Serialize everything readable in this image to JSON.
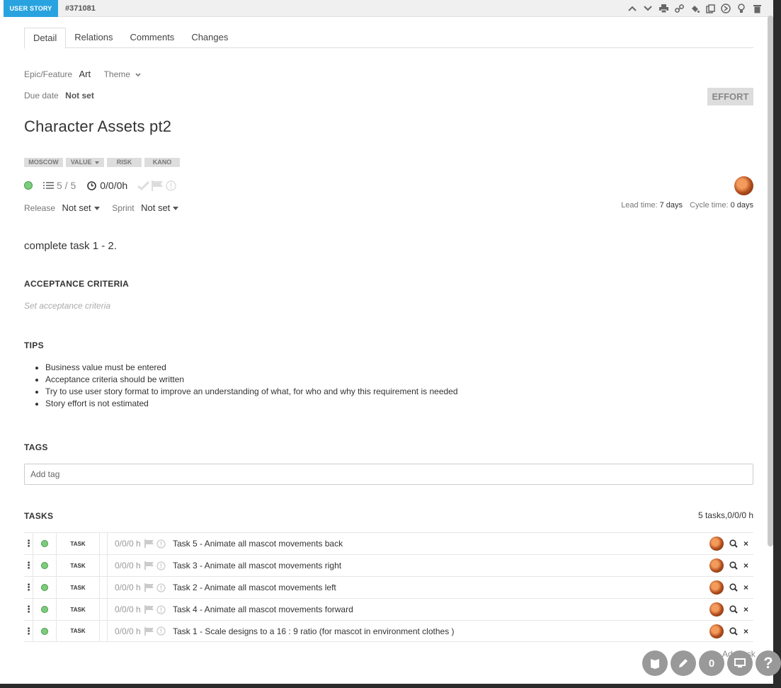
{
  "header": {
    "type_label": "USER STORY",
    "entity_id": "#371081",
    "icons": [
      "chevron-up-icon",
      "chevron-down-icon",
      "print-icon",
      "link-icon",
      "paint-bucket-icon",
      "copy-icon",
      "convert-icon",
      "lightbulb-icon",
      "trash-icon"
    ]
  },
  "tabs": [
    {
      "label": "Detail",
      "active": true
    },
    {
      "label": "Relations"
    },
    {
      "label": "Comments"
    },
    {
      "label": "Changes"
    }
  ],
  "meta": {
    "epic_label": "Epic/Feature",
    "epic_value": "Art",
    "theme_label": "Theme",
    "due_label": "Due date",
    "due_value": "Not set",
    "effort_label": "EFFORT"
  },
  "title": "Character Assets pt2",
  "priority_tags": [
    "MOSCOW",
    "VALUE",
    "RISK",
    "KANO"
  ],
  "status": {
    "tasks_progress": "5 / 5",
    "time": "0/0/0h"
  },
  "planning": {
    "release_label": "Release",
    "release_value": "Not set",
    "sprint_label": "Sprint",
    "sprint_value": "Not set",
    "lead_label": "Lead time:",
    "lead_value": "7 days",
    "cycle_label": "Cycle time:",
    "cycle_value": "0 days"
  },
  "description": "complete task 1 - 2.",
  "acceptance": {
    "heading": "ACCEPTANCE CRITERIA",
    "placeholder": "Set acceptance criteria"
  },
  "tips": {
    "heading": "TIPS",
    "items": [
      "Business value must be entered",
      "Acceptance criteria should be written",
      "Try to use user story format to improve an understanding of what, for who and why this requirement is needed",
      "Story effort is not estimated"
    ]
  },
  "tags": {
    "heading": "TAGS",
    "placeholder": "Add tag"
  },
  "tasks": {
    "heading": "TASKS",
    "summary": "5  tasks,0/0/0 h",
    "add_label": "Add task",
    "rows": [
      {
        "type": "TASK",
        "effort": "0/0/0 h",
        "name": "Task 5 - Animate all mascot movements back"
      },
      {
        "type": "TASK",
        "effort": "0/0/0 h",
        "name": "Task 3 - Animate all mascot movements right"
      },
      {
        "type": "TASK",
        "effort": "0/0/0 h",
        "name": "Task 2 - Animate all mascot movements left"
      },
      {
        "type": "TASK",
        "effort": "0/0/0 h",
        "name": "Task 4 - Animate all mascot movements forward"
      },
      {
        "type": "TASK",
        "effort": "0/0/0 h",
        "name": "Task 1 - Scale designs to a 16 : 9 ratio (for mascot in environment clothes )"
      }
    ]
  },
  "fabs": {
    "count": "0",
    "help": "?"
  },
  "colors": {
    "badge": "#29a3df",
    "state_green": "#7ccc7c"
  }
}
